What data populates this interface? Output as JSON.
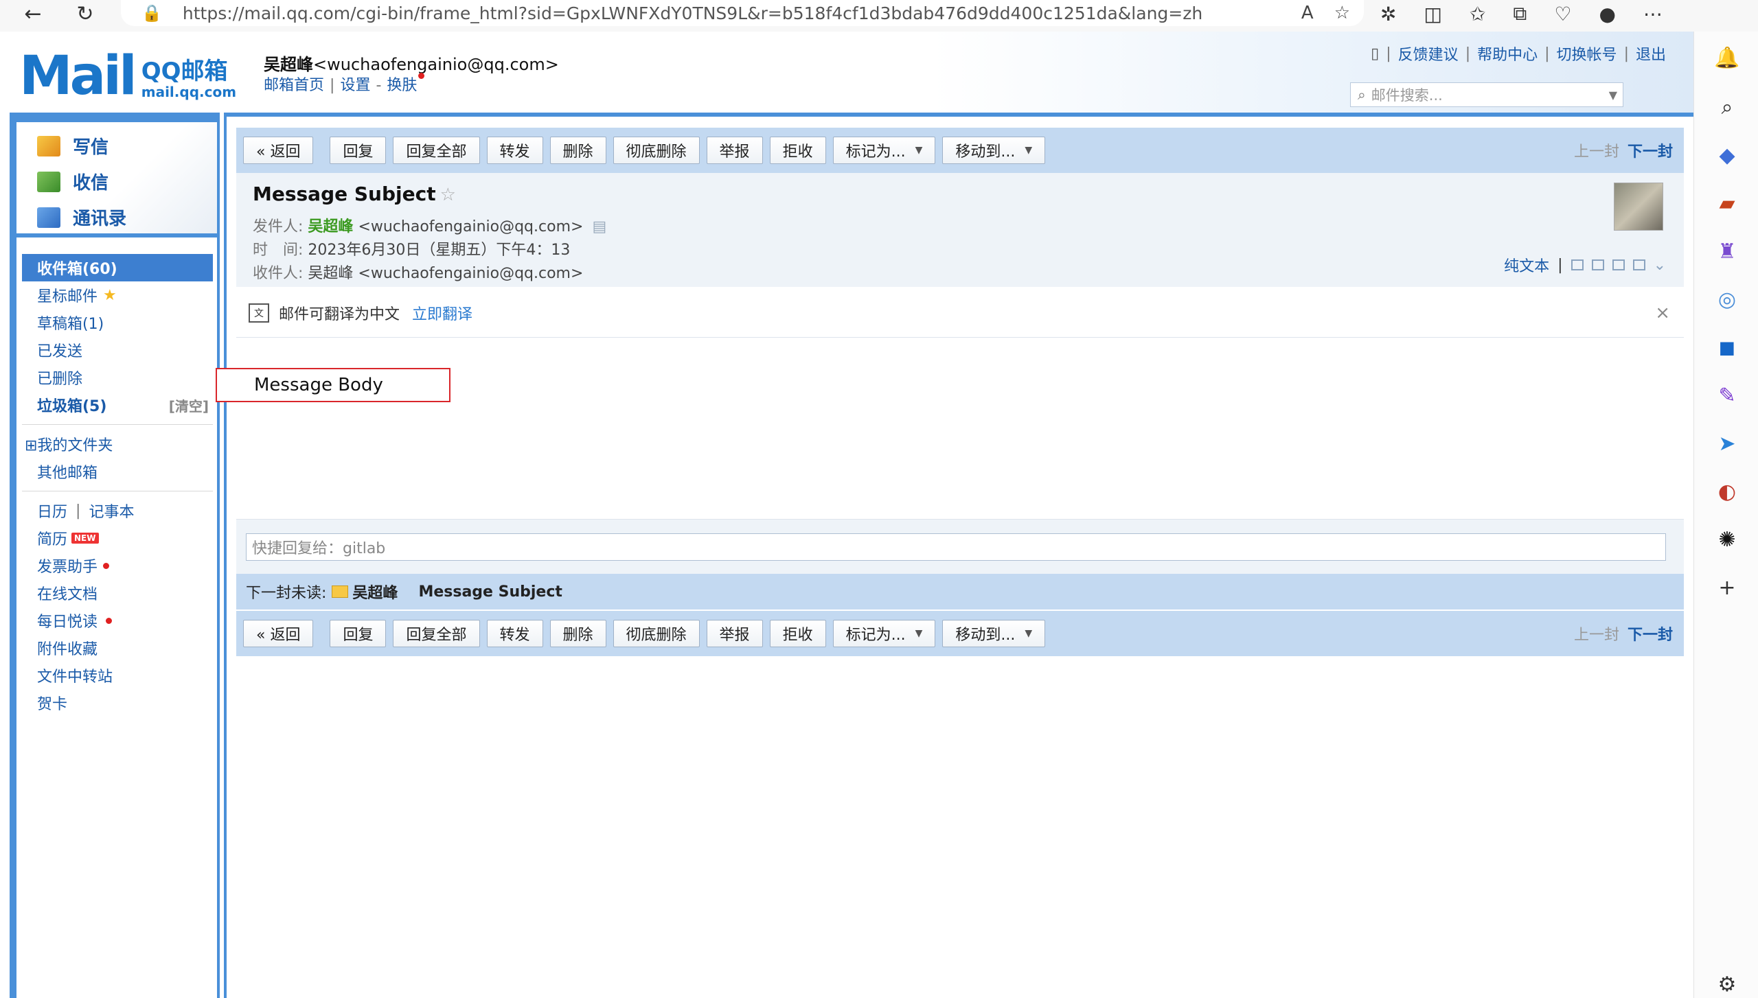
{
  "browser": {
    "url": "https://mail.qq.com/cgi-bin/frame_html?sid=GpxLWNFXdY0TNS9L&r=b518f4cf1d3bdab476d9dd400c1251da&lang=zh"
  },
  "header": {
    "logo_word": "Mail",
    "logo_brand": "QQ邮箱",
    "logo_domain": "mail.qq.com",
    "user_name": "吴超峰",
    "user_email": "<wuchaofengainio@qq.com>",
    "link_home": "邮箱首页",
    "link_settings": "设置",
    "link_sep": "-",
    "link_skin": "换肤",
    "top_feedback": "反馈建议",
    "top_help": "帮助中心",
    "top_switch": "切换帐号",
    "top_logout": "退出",
    "search_placeholder": "邮件搜索..."
  },
  "sidebar": {
    "compose": "写信",
    "receive": "收信",
    "contacts": "通讯录",
    "folders": [
      {
        "label": "收件箱(60)"
      },
      {
        "label": "星标邮件"
      },
      {
        "label": "草稿箱(1)"
      },
      {
        "label": "已发送"
      },
      {
        "label": "已删除"
      },
      {
        "label": "垃圾箱(5)",
        "action": "[清空]"
      }
    ],
    "my_folders": "⊞我的文件夹",
    "other_mailboxes": "其他邮箱",
    "calendar": "日历",
    "notes": "记事本",
    "resume": "简历",
    "new_badge": "NEW",
    "invoice": "发票助手",
    "online_docs": "在线文档",
    "daily_read": "每日悦读",
    "attachments": "附件收藏",
    "file_transfer": "文件中转站",
    "greeting_card": "贺卡"
  },
  "toolbar": {
    "back": "« 返回",
    "reply": "回复",
    "reply_all": "回复全部",
    "forward": "转发",
    "delete": "删除",
    "delete_perm": "彻底删除",
    "report": "举报",
    "reject": "拒收",
    "mark_as": "标记为...",
    "move_to": "移动到...",
    "prev": "上一封",
    "next": "下一封"
  },
  "message": {
    "subject": "Message Subject",
    "from_label": "发件人:",
    "from_name": "吴超峰",
    "from_email": "<wuchaofengainio@qq.com>",
    "time_label": "时　间:",
    "time_value": "2023年6月30日（星期五）下午4：13",
    "to_label": "收件人:",
    "to_value": "吴超峰 <wuchaofengainio@qq.com>",
    "plain_text": "纯文本",
    "body": "Message Body"
  },
  "translate": {
    "text": "邮件可翻译为中文",
    "link": "立即翻译"
  },
  "quick_reply": {
    "placeholder": "快捷回复给：gitlab"
  },
  "next_unread": {
    "label": "下一封未读:",
    "name": "吴超峰",
    "subject": "Message Subject"
  }
}
